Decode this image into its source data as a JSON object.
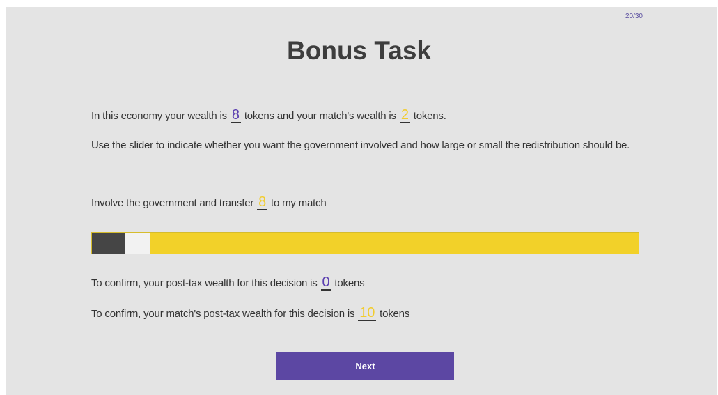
{
  "progress": "20/30",
  "title": "Bonus Task",
  "intro": {
    "p1": "In this economy your wealth is",
    "your_wealth": "8",
    "p2": "tokens and your match's wealth is",
    "match_wealth": "2",
    "p3": "tokens."
  },
  "instruction": "Use the slider to indicate whether you want the government involved and how large or small the redistribution should be.",
  "transfer": {
    "p1": "Involve the government and transfer",
    "amount": "8",
    "p2": "to my match"
  },
  "slider": {
    "position_fraction": 0.06,
    "left_color": "#454545",
    "right_color": "#f2d129"
  },
  "confirm_self": {
    "p1": "To confirm, your post-tax wealth for this decision is",
    "value": "0",
    "p2": "tokens"
  },
  "confirm_match": {
    "p1": "To confirm, your match's post-tax wealth for this decision is",
    "value": "10",
    "p2": "tokens"
  },
  "next_label": "Next",
  "colors": {
    "accent": "#5c47a3",
    "highlight": "#f2cc2c",
    "background": "#e4e4e4"
  }
}
